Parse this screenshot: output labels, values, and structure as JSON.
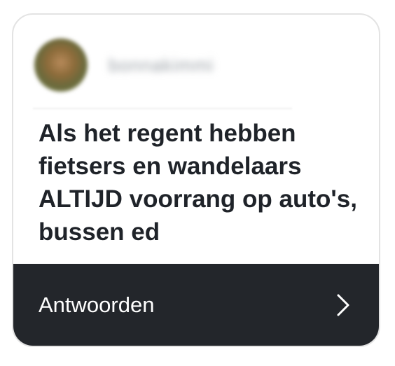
{
  "post": {
    "username": "bonnakimmi",
    "question": "Als het regent hebben fietsers en wandelaars ALTIJD voorrang op auto's, bussen ed"
  },
  "action": {
    "label": "Antwoorden",
    "icon": "chevron-right-icon"
  },
  "colors": {
    "card_border": "#e3e3e3",
    "text": "#1f2329",
    "action_bar": "#23262b",
    "action_text": "#ffffff"
  }
}
